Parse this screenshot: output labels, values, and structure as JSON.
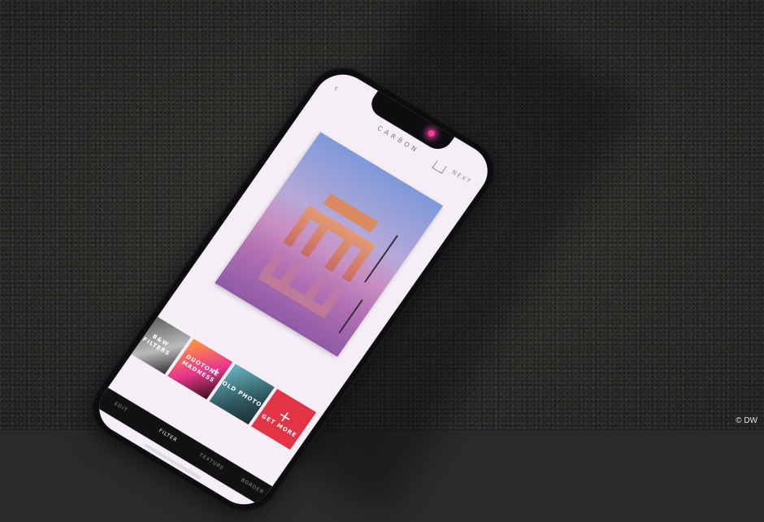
{
  "header": {
    "title": "CARBON",
    "next_label": "NEXT",
    "back_icon": "chevron-left-icon",
    "cart_icon": "cart-icon"
  },
  "tool_tiles": [
    {
      "label": "B&W FILTERS"
    },
    {
      "label": "DUOTONE MADNESS"
    },
    {
      "label": "OLD PHOTO"
    },
    {
      "label": "GET MORE"
    }
  ],
  "tabs": [
    {
      "label": "EDIT",
      "active": false
    },
    {
      "label": "FILTER",
      "active": true
    },
    {
      "label": "TEXTURE",
      "active": false
    },
    {
      "label": "BORDER",
      "active": false
    }
  ],
  "credit": "© DW",
  "colors": {
    "accent_red": "#e33446",
    "tab_bar": "#111111",
    "screen_bg": "#f6eef6"
  }
}
